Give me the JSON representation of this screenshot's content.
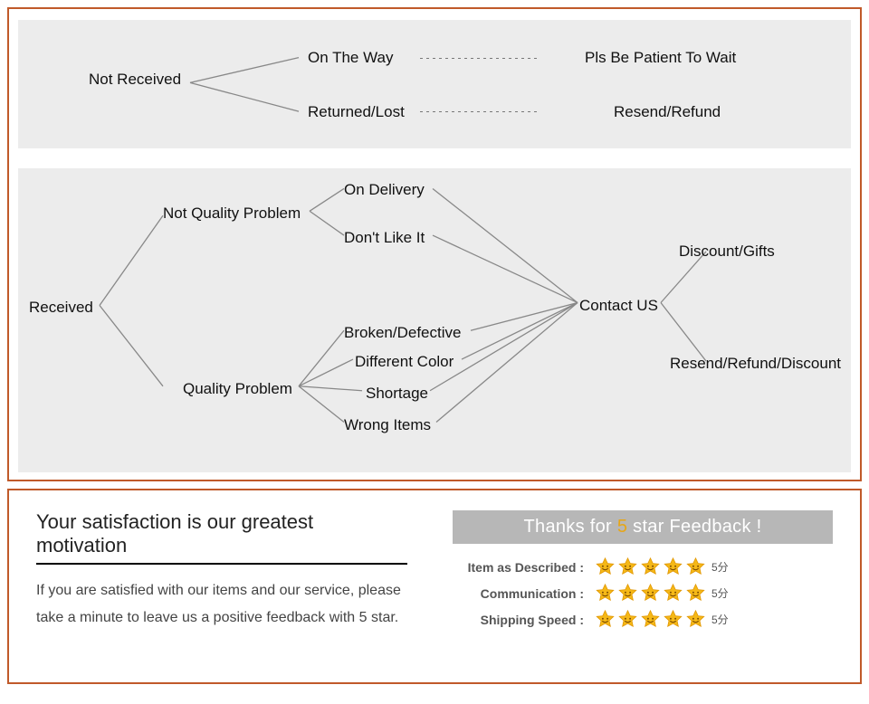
{
  "flow": {
    "notReceived": "Not Received",
    "onTheWay": "On The Way",
    "patient": "Pls Be Patient To Wait",
    "returnedLost": "Returned/Lost",
    "resendRefund": "Resend/Refund",
    "received": "Received",
    "notQuality": "Not Quality Problem",
    "qualityProblem": "Quality Problem",
    "onDelivery": "On Delivery",
    "dontLike": "Don't Like It",
    "broken": "Broken/Defective",
    "diffColor": "Different Color",
    "shortage": "Shortage",
    "wrongItems": "Wrong Items",
    "contactUs": "Contact US",
    "discountGifts": "Discount/Gifts",
    "resendRefundDiscount": "Resend/Refund/Discount"
  },
  "feedback": {
    "headline": "Your satisfaction is our greatest motivation",
    "body": "If you are satisfied with our items and our service, please take a minute to leave us a positive feedback with 5 star.",
    "bannerPre": "Thanks for ",
    "bannerFive": "5",
    "bannerPost": " star Feedback !",
    "rows": [
      {
        "label": "Item as Described :",
        "score": "5分"
      },
      {
        "label": "Communication :",
        "score": "5分"
      },
      {
        "label": "Shipping Speed :",
        "score": "5分"
      }
    ]
  }
}
